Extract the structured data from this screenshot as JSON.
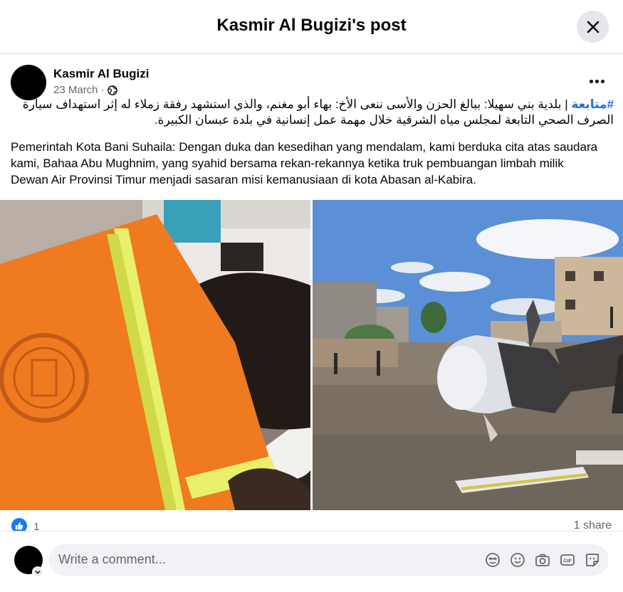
{
  "dialog": {
    "title": "Kasmir Al Bugizi's post"
  },
  "post": {
    "author": "Kasmir Al Bugizi",
    "date": "23 March",
    "meta_separator": "·",
    "privacy_icon": "globe-icon",
    "arabic_hashtag": "#متابعة",
    "arabic_text": " | بلدية بني سهيلا: ببالغ الحزن والأسى ننعى الأخ: بهاء أبو مغنم، والذي استشهد رفقة زملاء له إثر استهداف سيارة الصرف الصحي التابعة لمجلس مياه الشرقية خلال مهمة عمل إنسانية في بلدة عبسان الكبيرة.",
    "indonesian_text": "Pemerintah Kota Bani Suhaila: Dengan duka dan kesedihan yang mendalam, kami berduka cita atas saudara kami, Bahaa Abu Mughnim, yang syahid bersama rekan-rekannya ketika truk pembuangan limbah milik Dewan Air Provinsi Timur menjadi sasaran misi kemanusiaan di kota Abasan al-Kabira."
  },
  "reactions": {
    "like_count": "1",
    "shares": "1 share"
  },
  "comment": {
    "placeholder": "Write a comment...",
    "icons": [
      "avatar-sticker-icon",
      "emoji-icon",
      "camera-icon",
      "gif-icon",
      "sticker-icon"
    ]
  },
  "colors": {
    "hashtag": "#216fdb",
    "like_blue": "#1877f2",
    "secondary_text": "#65676b"
  }
}
